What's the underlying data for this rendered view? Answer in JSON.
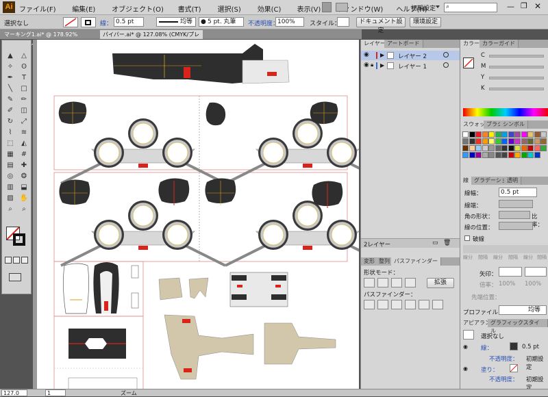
{
  "app": {
    "logo": "Ai"
  },
  "menu": [
    "ファイル(F)",
    "編集(E)",
    "オブジェクト(O)",
    "書式(T)",
    "選択(S)",
    "効果(C)",
    "表示(V)",
    "ウィンドウ(W)",
    "ヘルプ(H)"
  ],
  "workspace": "初期設定",
  "control": {
    "selection": "選択なし",
    "stroke_label": "線：",
    "stroke_value": "0.5 pt",
    "profile": "均等",
    "brush": "5 pt. 丸筆",
    "opacity_label": "不透明度：",
    "opacity_value": "100%",
    "style_label": "スタイル：",
    "doc_setup": "ドキュメント設定",
    "preferences": "環境設定"
  },
  "tabs": [
    {
      "label": "マーキング1.ai* @ 178.92% (CMYK/プレビュー)"
    },
    {
      "label": "パイパー.ai* @ 127.08% (CMYK/プレビュー)"
    }
  ],
  "layers": {
    "tabs": [
      "レイヤー",
      "アートボード"
    ],
    "items": [
      "レイヤー 2",
      "レイヤー 1"
    ],
    "count": "2レイヤー"
  },
  "pathfinder": {
    "tabs": [
      "変形",
      "整列",
      "パスファインダー"
    ],
    "shape_mode": "形状モード：",
    "expand": "拡張",
    "pathfinder_label": "パスファインダー："
  },
  "color": {
    "tabs": [
      "カラー",
      "カラーガイド"
    ],
    "channels": [
      "C",
      "M",
      "Y",
      "K"
    ]
  },
  "swatches": {
    "tabs": [
      "スウォッチ",
      "ブラシ",
      "シンボル"
    ]
  },
  "stroke": {
    "tabs": [
      "線",
      "グラデーション",
      "透明"
    ],
    "weight_label": "線幅：",
    "weight_value": "0.5 pt",
    "cap_label": "線端：",
    "corner_label": "角の形状：",
    "limit_label": "比率：",
    "limit_value": "10",
    "align_label": "線の位置：",
    "dash_label": "破線",
    "dash_fields": [
      "線分",
      "間隔",
      "線分",
      "間隔",
      "線分",
      "間隔"
    ],
    "arrow_label": "矢印：",
    "scale_label": "倍率：",
    "scale_values": [
      "100%",
      "100%"
    ],
    "tip_label": "先端位置：",
    "profile_label": "プロファイル：",
    "profile_value": "均等"
  },
  "appearance": {
    "tabs": [
      "アピアランス",
      "グラフィックスタイル"
    ],
    "none": "選択なし",
    "stroke_label": "線：",
    "stroke_value": "0.5 pt",
    "opacity_label": "不透明度：",
    "opacity_value": "初期設定",
    "fill_label": "塗り：",
    "opacity2_value": "初期設定"
  },
  "status": {
    "zoom": "127.0",
    "page": "1",
    "tool": "ズーム"
  },
  "colors": {
    "accent": "#d9241c",
    "tan": "#d2c6ab",
    "dark": "#2e2e2e"
  }
}
